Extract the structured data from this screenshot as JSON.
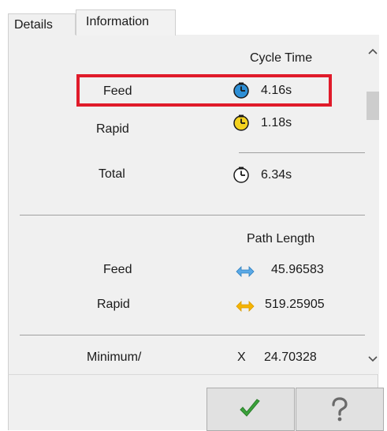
{
  "tabs": [
    {
      "label": "Details",
      "active": false
    },
    {
      "label": "Information",
      "active": true
    }
  ],
  "cycle_time": {
    "header": "Cycle Time",
    "rows": [
      {
        "label": "Feed",
        "value": "4.16s",
        "icon": "clock-blue-icon",
        "icon_color": "#2d8fd6",
        "highlighted": true
      },
      {
        "label": "Rapid",
        "value": "1.18s",
        "icon": "clock-yellow-icon",
        "icon_color": "#f4d21f",
        "highlighted": false
      },
      {
        "label": "Total",
        "value": "6.34s",
        "icon": "clock-white-icon",
        "icon_color": "#ffffff",
        "highlighted": false
      }
    ]
  },
  "path_length": {
    "header": "Path Length",
    "rows": [
      {
        "label": "Feed",
        "value": "45.96583",
        "icon": "double-arrow-blue-icon",
        "icon_color": "#5aa9e6"
      },
      {
        "label": "Rapid",
        "value": "519.25905",
        "icon": "double-arrow-orange-icon",
        "icon_color": "#f5b400"
      }
    ]
  },
  "extents": {
    "label": "Minimum/",
    "axis": "X",
    "value": "24.70328"
  },
  "highlight_color": "#e01b2a",
  "buttons": {
    "ok": {
      "icon": "checkmark-icon",
      "color": "#3aa23a"
    },
    "help": {
      "icon": "question-mark-icon"
    }
  }
}
